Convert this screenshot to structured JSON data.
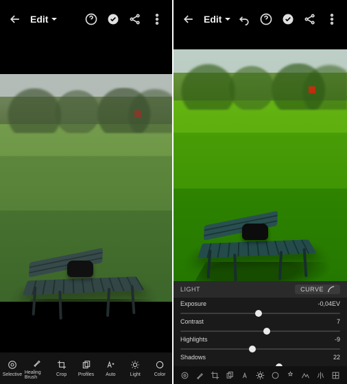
{
  "left": {
    "header": {
      "edit_label": "Edit"
    },
    "tools": [
      {
        "id": "selective",
        "label": "Selective"
      },
      {
        "id": "healing",
        "label": "Healing Brush"
      },
      {
        "id": "crop",
        "label": "Crop"
      },
      {
        "id": "profiles",
        "label": "Profiles"
      },
      {
        "id": "auto",
        "label": "Auto"
      },
      {
        "id": "light",
        "label": "Light"
      },
      {
        "id": "color",
        "label": "Color"
      }
    ]
  },
  "right": {
    "header": {
      "edit_label": "Edit"
    },
    "panel": {
      "title": "LIGHT",
      "curve_label": "CURVE"
    },
    "sliders": [
      {
        "name": "Exposure",
        "value": "-0,04EV",
        "pos": 49
      },
      {
        "name": "Contrast",
        "value": "7",
        "pos": 54
      },
      {
        "name": "Highlights",
        "value": "-9",
        "pos": 45
      },
      {
        "name": "Shadows",
        "value": "22",
        "pos": 62
      }
    ],
    "dock": [
      {
        "id": "selective"
      },
      {
        "id": "healing"
      },
      {
        "id": "crop"
      },
      {
        "id": "profiles"
      },
      {
        "id": "auto"
      },
      {
        "id": "light",
        "active": true
      },
      {
        "id": "color"
      },
      {
        "id": "effects"
      },
      {
        "id": "detail"
      },
      {
        "id": "optics"
      },
      {
        "id": "geometry"
      }
    ]
  }
}
